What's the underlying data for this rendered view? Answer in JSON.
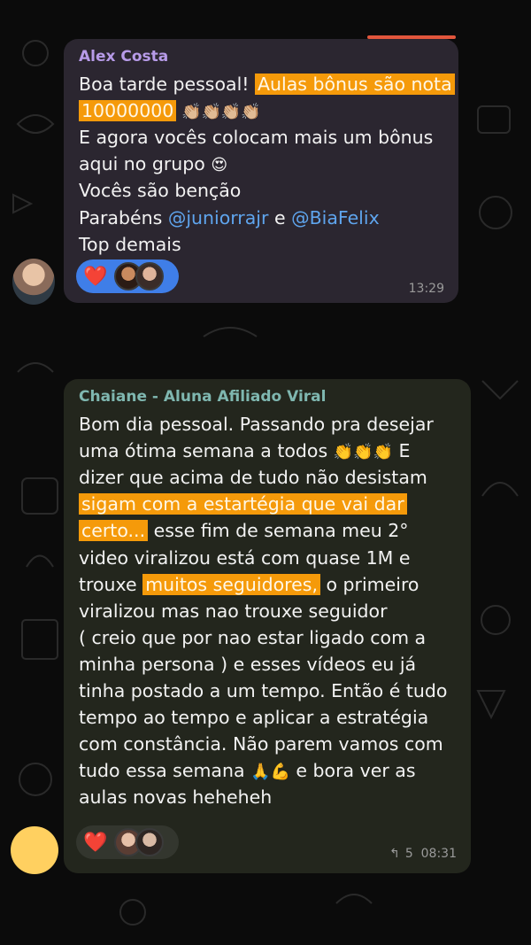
{
  "messages": [
    {
      "sender": "Alex Costa",
      "lines": [
        [
          {
            "t": "Boa tarde pessoal! "
          },
          {
            "t": "Aulas bônus são nota",
            "hl": true
          }
        ],
        [
          {
            "t": "10000000",
            "hl": true
          },
          {
            "t": " 👏🏼👏🏼👏🏼👏🏼",
            "emoji": true
          }
        ],
        [
          {
            "t": "E agora vocês colocam mais um bônus"
          }
        ],
        [
          {
            "t": "aqui no grupo "
          },
          {
            "t": "😍",
            "emoji": true
          }
        ],
        [
          {
            "t": "Vocês são benção"
          }
        ],
        [
          {
            "t": "Parabéns "
          },
          {
            "t": "@juniorrajr",
            "mention": true
          },
          {
            "t": " e "
          },
          {
            "t": "@BiaFelix",
            "mention": true
          }
        ],
        [
          {
            "t": "Top demais"
          }
        ]
      ],
      "reaction": "❤️",
      "time": "13:29"
    },
    {
      "sender": "Chaiane - Aluna Afiliado Viral",
      "lines": [
        [
          {
            "t": "Bom dia pessoal. Passando pra desejar"
          }
        ],
        [
          {
            "t": "uma ótima semana a todos "
          },
          {
            "t": "👏👏👏",
            "emoji": true
          },
          {
            "t": " E"
          }
        ],
        [
          {
            "t": "dizer que acima de tudo não desistam"
          }
        ],
        [
          {
            "t": "sigam com a estartégia que vai dar",
            "hl": true
          }
        ],
        [
          {
            "t": "certo...",
            "hl": true
          },
          {
            "t": " esse fim de semana meu 2°"
          }
        ],
        [
          {
            "t": "video viralizou está com quase 1M e"
          }
        ],
        [
          {
            "t": "trouxe "
          },
          {
            "t": "muitos seguidores,",
            "hl": true
          },
          {
            "t": " o primeiro"
          }
        ],
        [
          {
            "t": "viralizou mas nao trouxe seguidor"
          }
        ],
        [
          {
            "t": "( creio que por nao estar ligado com a"
          }
        ],
        [
          {
            "t": "minha persona ) e esses vídeos eu já"
          }
        ],
        [
          {
            "t": "tinha postado a um tempo. Então é tudo"
          }
        ],
        [
          {
            "t": "tempo ao tempo e aplicar a estratégia"
          }
        ],
        [
          {
            "t": "com constância. Não parem vamos com"
          }
        ],
        [
          {
            "t": "tudo essa semana "
          },
          {
            "t": "🙏💪",
            "emoji": true
          },
          {
            "t": " e bora ver as"
          }
        ],
        [
          {
            "t": "aulas novas  heheheh"
          }
        ]
      ],
      "reaction": "❤️",
      "forwards": "5",
      "time": "08:31"
    }
  ]
}
